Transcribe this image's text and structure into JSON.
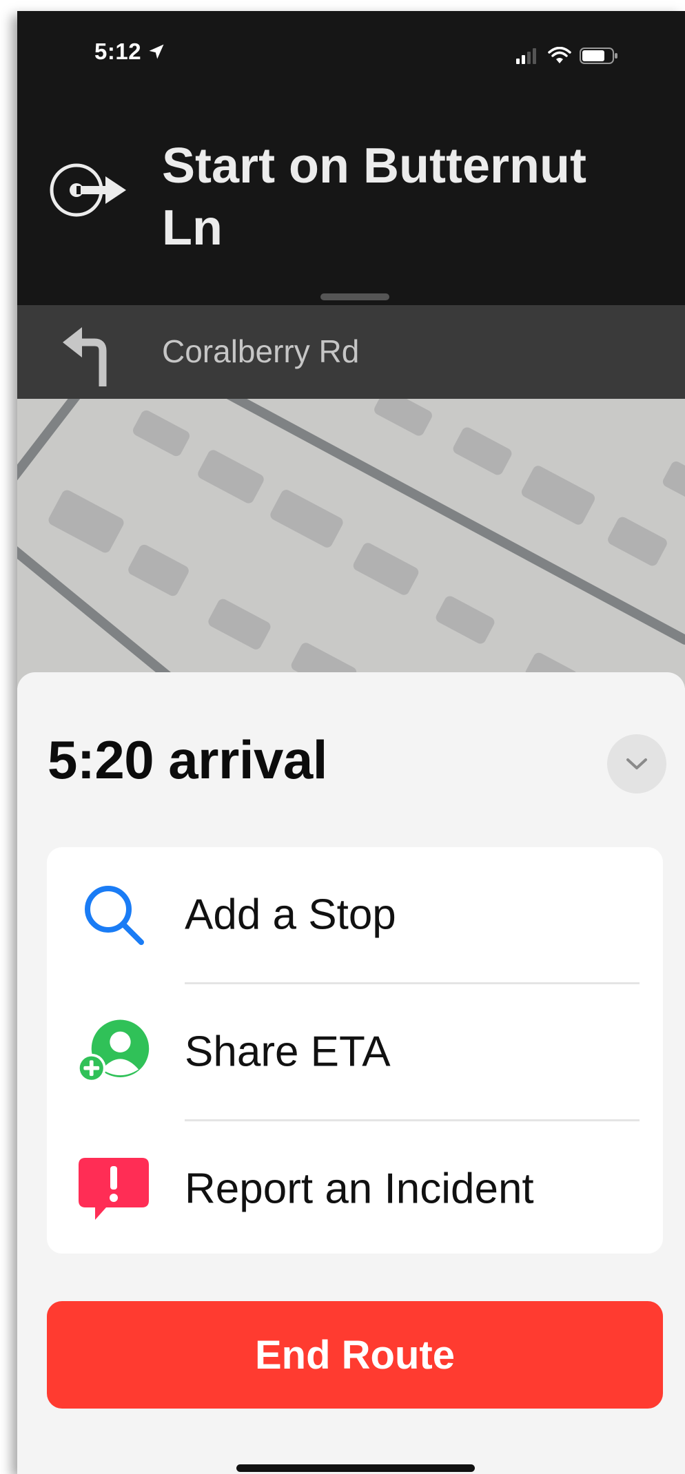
{
  "status_bar": {
    "time": "5:12",
    "location_icon": "location-arrow-icon",
    "signal_icon": "cellular-signal-icon",
    "wifi_icon": "wifi-icon",
    "battery_icon": "battery-icon"
  },
  "instruction": {
    "icon": "start-route-arrow-icon",
    "text": "Start on Butternut Ln"
  },
  "next_maneuver": {
    "icon": "turn-left-arrow-icon",
    "street": "Coralberry Rd"
  },
  "trip": {
    "arrival": "5:20 arrival",
    "collapse_icon": "chevron-down-icon"
  },
  "actions": [
    {
      "label": "Add a Stop",
      "icon": "search-icon",
      "color": "#1a7cf5"
    },
    {
      "label": "Share ETA",
      "icon": "share-eta-person-add-icon",
      "color": "#30c158"
    },
    {
      "label": "Report an Incident",
      "icon": "report-incident-icon",
      "color": "#ff2d55"
    }
  ],
  "end_route": {
    "label": "End Route",
    "color": "#ff3b30"
  }
}
